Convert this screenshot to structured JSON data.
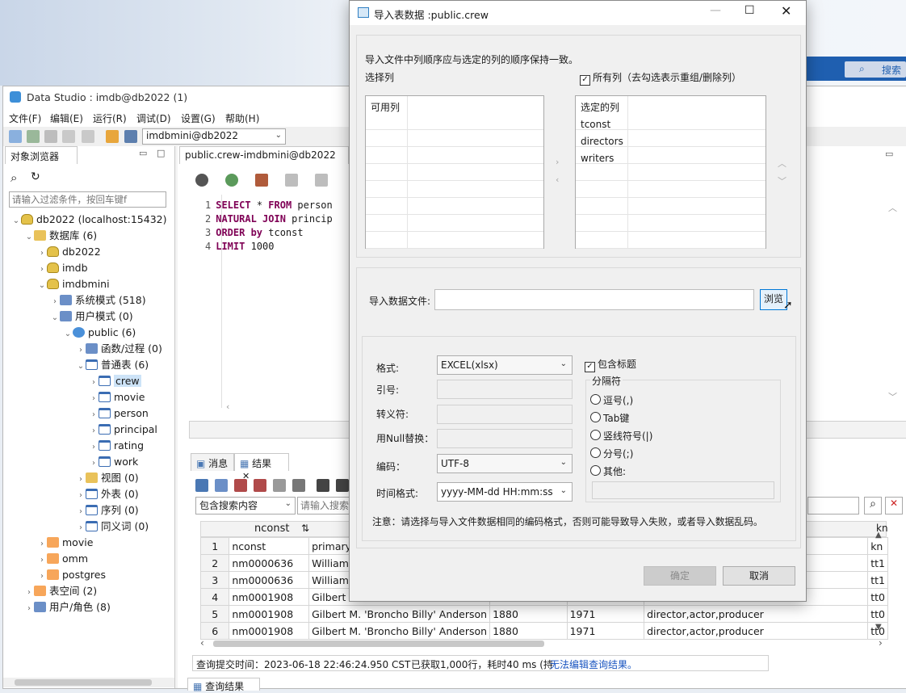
{
  "desktop": {
    "search_label": "搜索"
  },
  "main_window": {
    "title": "Data Studio : imdb@db2022 (1)",
    "menu": [
      "文件(F)",
      "编辑(E)",
      "运行(R)",
      "调试(D)",
      "设置(G)",
      "帮助(H)"
    ],
    "connection_combo": "imdbmini@db2022",
    "editor_tab": "public.crew-imdbmini@db2022"
  },
  "object_browser": {
    "tab": "对象浏览器",
    "filter_placeholder": "请输入过滤条件，按回车键f",
    "tree": [
      {
        "label": "db2022 (localhost:15432)",
        "level": 0,
        "icon": "server-icon",
        "twisty": "open"
      },
      {
        "label": "数据库 (6)",
        "level": 1,
        "icon": "folder-icon",
        "twisty": "open"
      },
      {
        "label": "db2022",
        "level": 2,
        "icon": "database-icon",
        "twisty": "closed"
      },
      {
        "label": "imdb",
        "level": 2,
        "icon": "database-icon",
        "twisty": "closed"
      },
      {
        "label": "imdbmini",
        "level": 2,
        "icon": "database-icon",
        "twisty": "open"
      },
      {
        "label": "系统模式 (518)",
        "level": 3,
        "icon": "system-schema-icon",
        "twisty": "closed"
      },
      {
        "label": "用户模式 (0)",
        "level": 3,
        "icon": "user-schema-icon",
        "twisty": "open"
      },
      {
        "label": "public (6)",
        "level": 4,
        "icon": "schema-icon",
        "twisty": "open"
      },
      {
        "label": "函数/过程 (0)",
        "level": 5,
        "icon": "function-icon",
        "twisty": "closed"
      },
      {
        "label": "普通表 (6)",
        "level": 5,
        "icon": "table-icon",
        "twisty": "open"
      },
      {
        "label": "crew",
        "level": 6,
        "icon": "table-icon",
        "twisty": "closed"
      },
      {
        "label": "movie",
        "level": 6,
        "icon": "table-icon",
        "twisty": "closed"
      },
      {
        "label": "person",
        "level": 6,
        "icon": "table-icon",
        "twisty": "closed"
      },
      {
        "label": "principal",
        "level": 6,
        "icon": "table-icon",
        "twisty": "closed"
      },
      {
        "label": "rating",
        "level": 6,
        "icon": "table-icon",
        "twisty": "closed"
      },
      {
        "label": "work",
        "level": 6,
        "icon": "table-icon",
        "twisty": "closed"
      },
      {
        "label": "视图 (0)",
        "level": 5,
        "icon": "view-icon",
        "twisty": "closed"
      },
      {
        "label": "外表 (0)",
        "level": 5,
        "icon": "foreign-table-icon",
        "twisty": "closed"
      },
      {
        "label": "序列 (0)",
        "level": 5,
        "icon": "sequence-icon",
        "twisty": "closed"
      },
      {
        "label": "同义词 (0)",
        "level": 5,
        "icon": "synonym-icon",
        "twisty": "closed"
      },
      {
        "label": "movie",
        "level": 2,
        "icon": "database-red-icon",
        "twisty": "closed"
      },
      {
        "label": "omm",
        "level": 2,
        "icon": "database-red-icon",
        "twisty": "closed"
      },
      {
        "label": "postgres",
        "level": 2,
        "icon": "database-red-icon",
        "twisty": "closed"
      },
      {
        "label": "表空间 (2)",
        "level": 1,
        "icon": "tablespace-icon",
        "twisty": "closed"
      },
      {
        "label": "用户/角色 (8)",
        "level": 1,
        "icon": "users-icon",
        "twisty": "closed"
      }
    ]
  },
  "editor": {
    "lines": [
      {
        "num": "1",
        "kw1": "SELECT",
        "rest1": " * ",
        "kw2": "FROM",
        "rest2": " person"
      },
      {
        "num": "2",
        "kw1": "NATURAL JOIN",
        "rest1": " princip",
        "kw2": "",
        "rest2": ""
      },
      {
        "num": "3",
        "kw1": "ORDER by",
        "rest1": " tconst",
        "kw2": "",
        "rest2": ""
      },
      {
        "num": "4",
        "kw1": "LIMIT",
        "rest1": " 1000",
        "kw2": "",
        "rest2": ""
      }
    ]
  },
  "results": {
    "tab_messages": "消息",
    "tab_results": "结果",
    "search_scope": "包含搜索内容",
    "search_placeholder": "请输入搜索内",
    "column_header": "nconst",
    "last_col_header": "kn",
    "rows": [
      [
        "1",
        "nconst",
        "primary",
        "",
        "",
        "",
        "kn"
      ],
      [
        "2",
        "nm0000636",
        "William",
        "",
        "",
        "",
        "tt1"
      ],
      [
        "3",
        "nm0000636",
        "William",
        "",
        "",
        "",
        "tt1"
      ],
      [
        "4",
        "nm0001908",
        "Gilbert M",
        "",
        "",
        "",
        "tt0"
      ],
      [
        "5",
        "nm0001908",
        "Gilbert M. 'Broncho Billy' Anderson",
        "1880",
        "1971",
        "director,actor,producer",
        "tt0"
      ],
      [
        "6",
        "nm0001908",
        "Gilbert M. 'Broncho Billy' Anderson",
        "1880",
        "1971",
        "director,actor,producer",
        "tt0"
      ]
    ],
    "status_time": "查询提交时间：2023-06-18 22:46:24.950 CST",
    "status_rows": "已获取1,000行，耗时40 ms (持",
    "status_link": "无法编辑查询结果。",
    "bottom_tab": "查询结果"
  },
  "dialog": {
    "title": "导入表数据 :public.crew",
    "hint": "导入文件中列顺序应与选定的列的顺序保持一致。",
    "select_columns_label": "选择列",
    "all_columns_label": "所有列（去勾选表示重组/删除列）",
    "available_header": "可用列",
    "selected_header": "选定的列",
    "selected_columns": [
      "tconst",
      "directors",
      "writers"
    ],
    "file_label": "导入数据文件:",
    "file_value": "",
    "browse_button": "浏览",
    "format_label": "格式:",
    "format_value": "EXCEL(xlsx)",
    "quote_label": "引号:",
    "escape_label": "转义符:",
    "null_label": "用Null替换：",
    "encoding_label": "编码：",
    "encoding_value": "UTF-8",
    "time_format_label": "时间格式:",
    "time_format_value": "yyyy-MM-dd HH:mm:ss",
    "include_header_label": "包含标题",
    "delimiter_group_label": "分隔符",
    "delimiters": [
      "逗号(,)",
      "Tab键",
      "竖线符号(|)",
      "分号(;)",
      "其他:"
    ],
    "note": "注意：请选择与导入文件数据相同的编码格式，否则可能导致导入失败，或者导入数据乱码。",
    "ok_button": "确定",
    "cancel_button": "取消"
  }
}
